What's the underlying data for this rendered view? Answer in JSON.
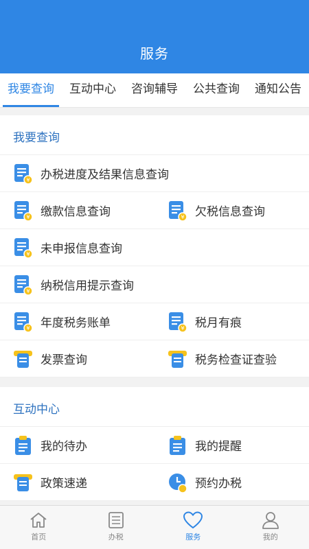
{
  "header": {
    "title": "服务"
  },
  "tabs": [
    {
      "label": "我要查询",
      "active": true
    },
    {
      "label": "互动中心",
      "active": false
    },
    {
      "label": "咨询辅导",
      "active": false
    },
    {
      "label": "公共查询",
      "active": false
    },
    {
      "label": "通知公告",
      "active": false
    }
  ],
  "sections": {
    "query": {
      "title": "我要查询",
      "items": {
        "progress": {
          "label": "办税进度及结果信息查询",
          "icon": "document-list-icon"
        },
        "payment": {
          "label": "缴款信息查询",
          "icon": "document-list-icon"
        },
        "arrears": {
          "label": "欠税信息查询",
          "icon": "document-list-icon"
        },
        "undeclared": {
          "label": "未申报信息查询",
          "icon": "document-list-icon"
        },
        "credit": {
          "label": "纳税信用提示查询",
          "icon": "document-list-icon"
        },
        "annual": {
          "label": "年度税务账单",
          "icon": "document-list-icon"
        },
        "monthly": {
          "label": "税月有痕",
          "icon": "document-list-icon"
        },
        "invoice": {
          "label": "发票查询",
          "icon": "invoice-printer-icon"
        },
        "inspection": {
          "label": "税务检查证查验",
          "icon": "invoice-printer-icon"
        }
      }
    },
    "interact": {
      "title": "互动中心",
      "items": {
        "todo": {
          "label": "我的待办",
          "icon": "clipboard-icon"
        },
        "reminder": {
          "label": "我的提醒",
          "icon": "clipboard-icon"
        },
        "policy": {
          "label": "政策速递",
          "icon": "invoice-printer-icon"
        },
        "appointment": {
          "label": "预约办税",
          "icon": "clock-icon"
        }
      }
    }
  },
  "tabbar": [
    {
      "label": "首页",
      "icon": "home-icon",
      "active": false
    },
    {
      "label": "办税",
      "icon": "list-icon",
      "active": false
    },
    {
      "label": "服务",
      "icon": "heart-icon",
      "active": true
    },
    {
      "label": "我的",
      "icon": "person-icon",
      "active": false
    }
  ],
  "colors": {
    "primary": "#2f86e4",
    "icon_blue": "#3a8ee6",
    "badge_yellow": "#f6c21c"
  }
}
